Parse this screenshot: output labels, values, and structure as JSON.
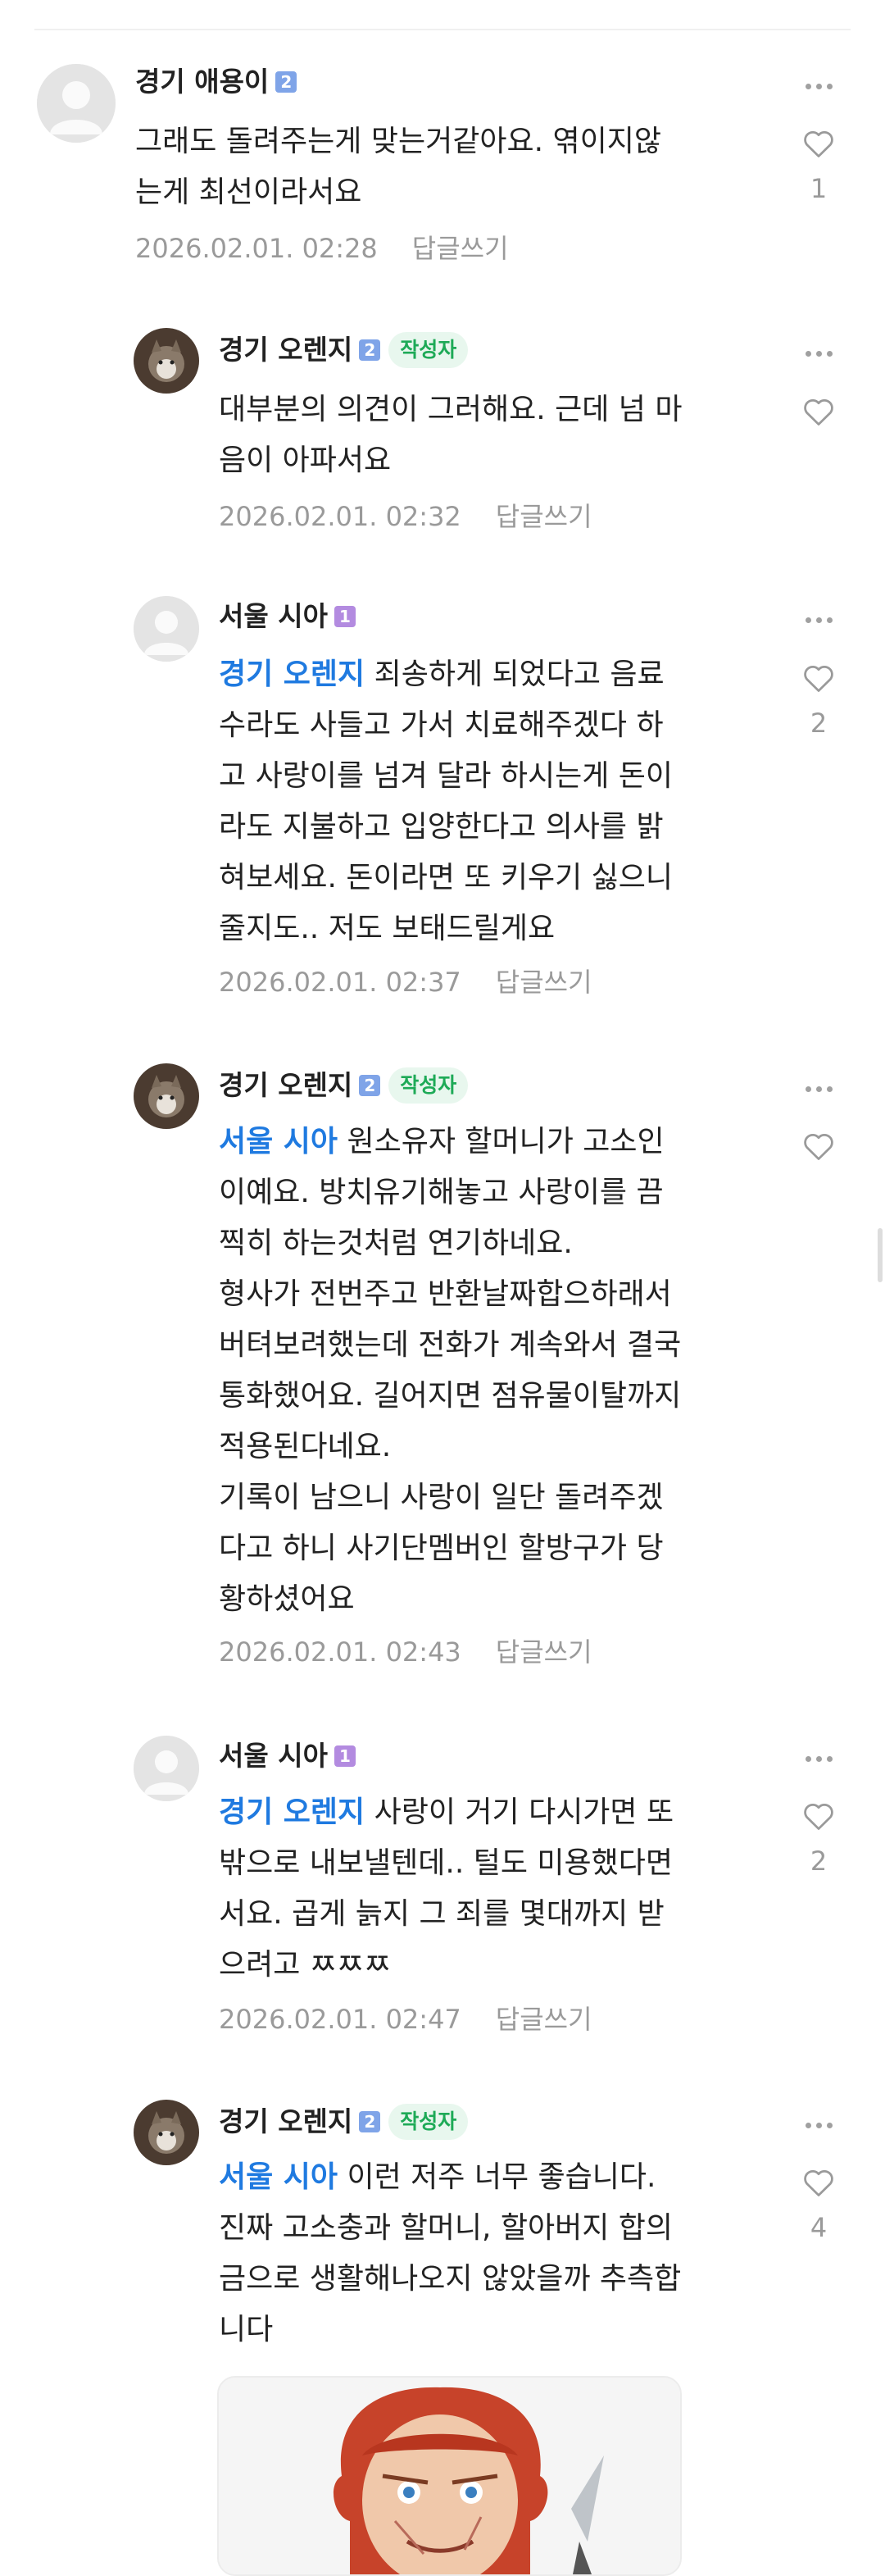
{
  "reply_label": "답글쓰기",
  "comments": [
    {
      "author": "경기 애용이",
      "level": "2",
      "badge": "",
      "mention": "",
      "text": "그래도 돌려주는게 맞는거같아요. 엮이지않\n는게 최선이라서요",
      "date": "2026.02.01. 02:28",
      "likes": "1"
    },
    {
      "author": "경기 오렌지",
      "level": "2",
      "badge": "작성자",
      "mention": "",
      "text": "대부분의 의견이 그러해요. 근데 넘 마\n음이 아파서요",
      "date": "2026.02.01. 02:32",
      "likes": ""
    },
    {
      "author": "서울 시아",
      "level": "1",
      "badge": "",
      "mention": "경기 오렌지",
      "text": " 죄송하게 되었다고 음료\n수라도 사들고 가서 치료해주겠다 하\n고 사랑이를 넘겨 달라 하시는게 돈이\n라도 지불하고 입양한다고 의사를 밝\n혀보세요. 돈이라면 또 키우기 싫으니\n줄지도.. 저도 보태드릴게요",
      "date": "2026.02.01. 02:37",
      "likes": "2"
    },
    {
      "author": "경기 오렌지",
      "level": "2",
      "badge": "작성자",
      "mention": "서울 시아",
      "text": " 원소유자 할머니가 고소인\n이예요. 방치유기해놓고 사랑이를 끔\n찍히 하는것처럼 연기하네요.\n형사가 전번주고 반환날짜합으하래서\n버텨보려했는데 전화가 계속와서 결국\n통화했어요. 길어지면 점유물이탈까지\n적용된다네요.\n기록이 남으니 사랑이 일단 돌려주겠\n다고 하니 사기단멤버인 할방구가 당\n황하셨어요",
      "date": "2026.02.01. 02:43",
      "likes": ""
    },
    {
      "author": "서울 시아",
      "level": "1",
      "badge": "",
      "mention": "경기 오렌지",
      "text": " 사랑이 거기 다시가면 또\n밖으로 내보낼텐데.. 털도 미용했다면\n서요. 곱게 늙지 그 죄를 몇대까지 받\n으려고 ㅉㅉㅉ",
      "date": "2026.02.01. 02:47",
      "likes": "2"
    },
    {
      "author": "경기 오렌지",
      "level": "2",
      "badge": "작성자",
      "mention": "서울 시아",
      "text": " 이런 저주 너무 좋습니다.\n진짜 고소충과 할머니, 할아버지 합의\n금으로 생활해나오지 않았을까 추측합\n니다",
      "date": "",
      "likes": "4"
    }
  ]
}
